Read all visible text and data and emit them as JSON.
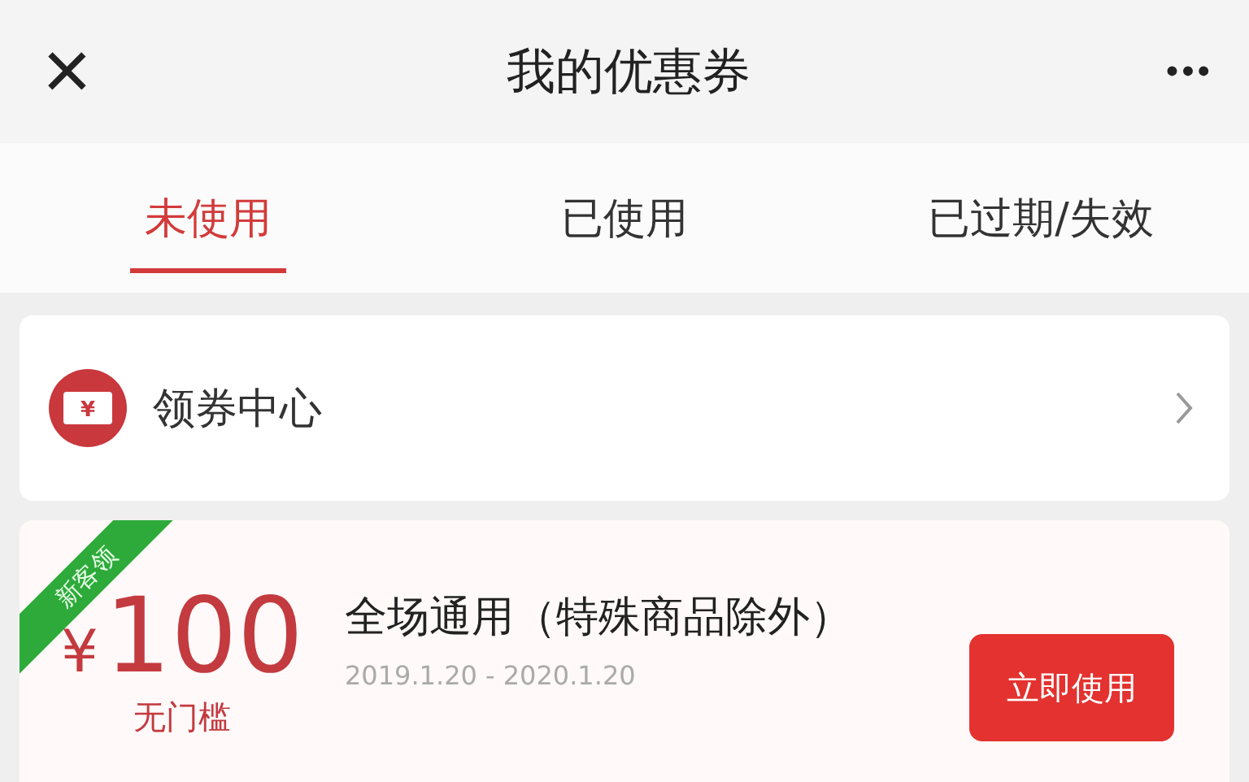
{
  "header": {
    "close": "×",
    "title": "我的优惠券",
    "more": "•••"
  },
  "tabs": [
    {
      "label": "未使用",
      "selected": true
    },
    {
      "label": "已使用",
      "selected": false
    },
    {
      "label": "已过期/失效",
      "selected": false
    }
  ],
  "center_row": {
    "label": "领券中心",
    "icon_glyph": "¥"
  },
  "coupons": [
    {
      "badge": "新客领",
      "currency": "¥",
      "amount": "100",
      "condition": "无门槛",
      "title": "全场通用（特殊商品除外）",
      "validity": "2019.1.20 - 2020.1.20",
      "button": "立即使用"
    }
  ]
}
